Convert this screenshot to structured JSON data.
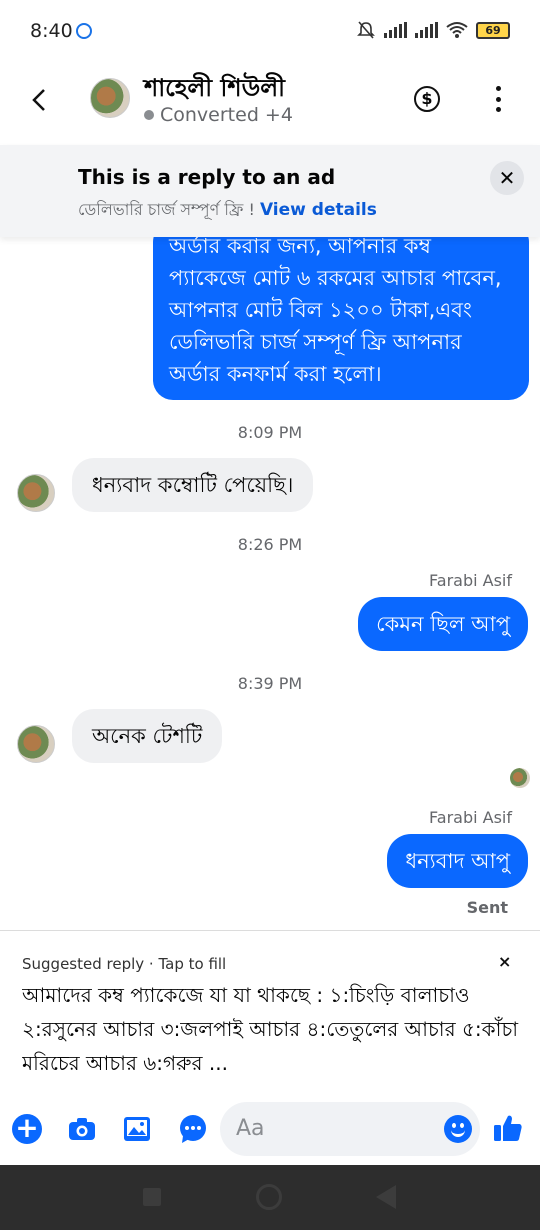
{
  "status_bar": {
    "time": "8:40",
    "battery": "69"
  },
  "header": {
    "name": "শাহেলী শিউলী",
    "subtitle": "Converted +4"
  },
  "ad_banner": {
    "title": "This is a reply to an ad",
    "subtitle": "ডেলিভারি চার্জ সম্পূর্ণ ফ্রি ! ",
    "link": "View details"
  },
  "messages": {
    "out_big": "অর্ডার করার জন্য, আপনার কম্ব প্যাকেজে মোট ৬ রকমের আচার পাবেন, আপনার মোট বিল ১২০০ টাকা,এবং ডেলিভারি চার্জ সম্পূর্ণ ফ্রি আপনার অর্ডার কনফার্ম করা হলো।",
    "time1": "8:09 PM",
    "in1": "ধন্যবাদ কম্বোটি পেয়েছি।",
    "time2": "8:26 PM",
    "sender1": "Farabi Asif",
    "out1": "কেমন ছিল আপু",
    "time3": "8:39 PM",
    "in2": "অনেক টেশটি",
    "sender2": "Farabi Asif",
    "out2": "ধন্যবাদ আপু",
    "sent": "Sent"
  },
  "suggested": {
    "head": "Suggested reply · Tap to fill",
    "close": "×",
    "text": "আমাদের কম্ব প্যাকেজে যা যা থাকছে : ১:চিংড়ি বালাচাও ২:রসুনের আচার ৩:জলপাই আচার ৪:তেতুলের আচার ৫:কাঁচা মরিচের আচার ৬:গরুর ..."
  },
  "composer": {
    "placeholder": "Aa"
  },
  "colors": {
    "accent": "#0a68ff",
    "incoming": "#eff0f2"
  }
}
